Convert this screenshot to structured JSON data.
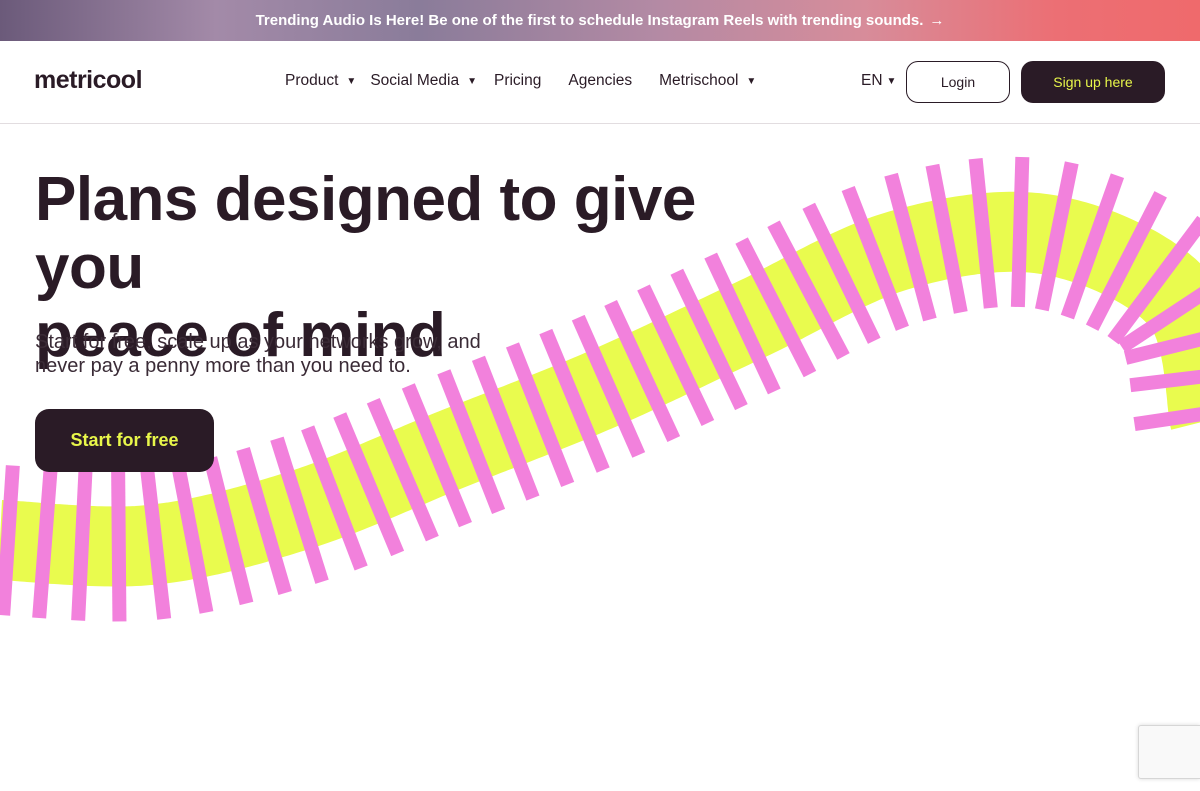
{
  "announcement": {
    "text": "Trending Audio Is Here! Be one of the first to schedule Instagram Reels with trending sounds.",
    "arrow": "→"
  },
  "nav": {
    "logo": "metricool",
    "menu": [
      {
        "label": "Product",
        "has_dropdown": true
      },
      {
        "label": "Social Media",
        "has_dropdown": true
      },
      {
        "label": "Pricing",
        "has_dropdown": false
      },
      {
        "label": "Agencies",
        "has_dropdown": false
      },
      {
        "label": "Metrischool",
        "has_dropdown": true
      }
    ],
    "caret_glyph": "▼",
    "language": "EN",
    "language_chevron": "⌄",
    "login": "Login",
    "signup": "Sign up here"
  },
  "hero": {
    "title_line1": "Plans designed to give you",
    "title_line2": "peace of mind",
    "subtitle_line1": "Start for free, scale up as your networks grow, and",
    "subtitle_line2": "never pay a penny more than you need to.",
    "cta": "Start for free"
  },
  "colors": {
    "dark": "#2a1b26",
    "accent_yellow": "#e8f74a",
    "wave_lime": "#e9fb4e",
    "wave_pink": "#f281dc"
  }
}
